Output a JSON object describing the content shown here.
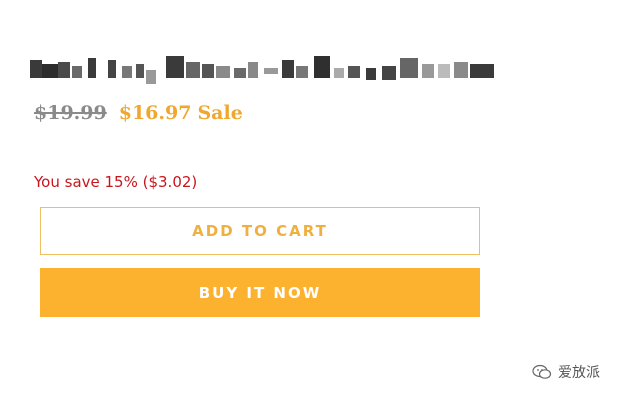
{
  "product": {
    "title_text": "Walking Pl… (obscured product title)",
    "price_original": "$19.99",
    "price_sale": "$16.97",
    "sale_label": "Sale",
    "savings_text": "You save 15% ($3.02)"
  },
  "actions": {
    "add_to_cart_label": "ADD TO CART",
    "buy_now_label": "BUY IT NOW"
  },
  "watermark": {
    "icon": "wechat-icon",
    "text": "爱放派"
  },
  "colors": {
    "accent": "#fdb22f",
    "sale_text": "#f0a72e",
    "savings_text": "#c8161d",
    "original_price": "#8a8a8a"
  }
}
